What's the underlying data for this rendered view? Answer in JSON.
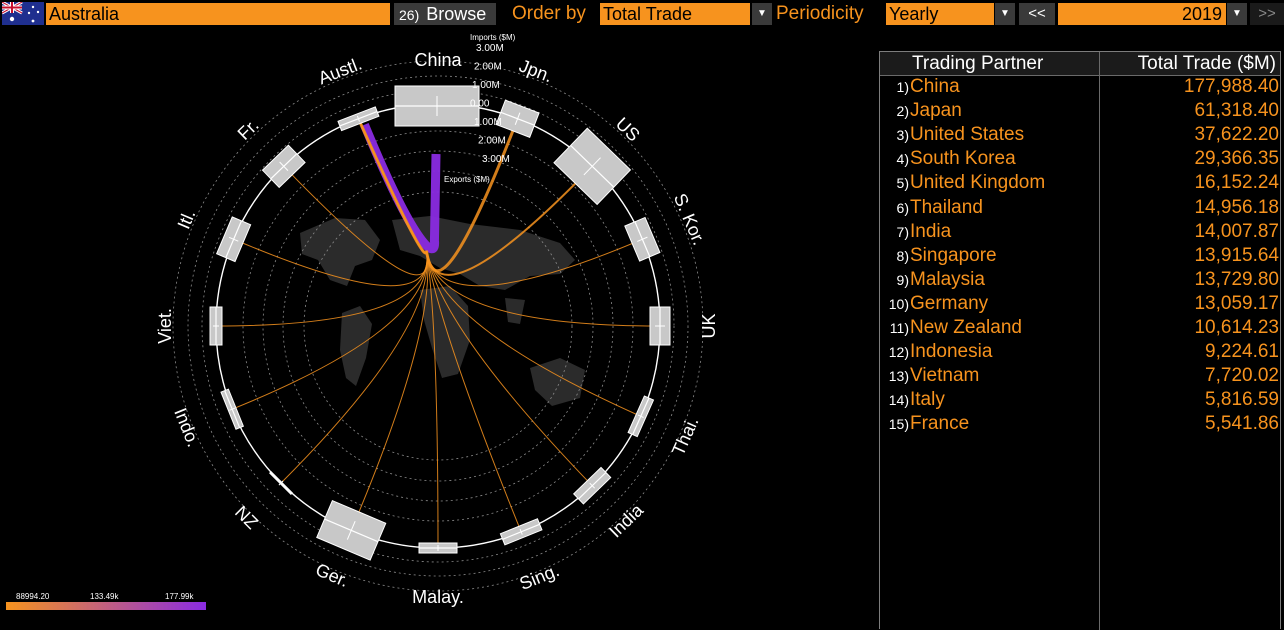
{
  "toolbar": {
    "country": "Australia",
    "browse_num": "26)",
    "browse_label": "Browse",
    "order_by_label": "Order by",
    "order_by_value": "Total Trade",
    "periodicity_label": "Periodicity",
    "periodicity_value": "Yearly",
    "prev_label": "<<",
    "year": "2019",
    "next_label": ">>"
  },
  "chord": {
    "center": "Austl.",
    "scale_imports_label": "Imports ($M)",
    "scale_exports_label": "Exports ($M)",
    "scale_ticks": [
      "3.00M",
      "2.00M",
      "1.00M",
      "0.00",
      "1.00M",
      "2.00M",
      "3.00M"
    ],
    "partners": [
      {
        "label": "China",
        "angle": 0
      },
      {
        "label": "Jpn.",
        "angle": 21
      },
      {
        "label": "US",
        "angle": 44
      },
      {
        "label": "S. Kor.",
        "angle": 67
      },
      {
        "label": "UK",
        "angle": 90
      },
      {
        "label": "Thai.",
        "angle": 114
      },
      {
        "label": "India",
        "angle": 136
      },
      {
        "label": "Sing.",
        "angle": 158
      },
      {
        "label": "Malay.",
        "angle": 180
      },
      {
        "label": "Ger.",
        "angle": 203
      },
      {
        "label": "NZ",
        "angle": 225
      },
      {
        "label": "Indo.",
        "angle": 248
      },
      {
        "label": "Viet.",
        "angle": 270
      },
      {
        "label": "Itl.",
        "angle": 293
      },
      {
        "label": "Fr.",
        "angle": 316
      },
      {
        "label": "Austl.",
        "angle": 339
      }
    ],
    "legend_ticks": [
      "88994.20",
      "133.49k",
      "177.99k"
    ],
    "colors": {
      "orange": "#f7931e",
      "purple": "#8a2be2",
      "box": "#c8c8c8"
    }
  },
  "table": {
    "col_partner": "Trading Partner",
    "col_total": "Total Trade ($M)",
    "rows": [
      {
        "rank": "1)",
        "name": "China",
        "value": "177,988.40"
      },
      {
        "rank": "2)",
        "name": "Japan",
        "value": "61,318.40"
      },
      {
        "rank": "3)",
        "name": "United States",
        "value": "37,622.20"
      },
      {
        "rank": "4)",
        "name": "South Korea",
        "value": "29,366.35"
      },
      {
        "rank": "5)",
        "name": "United Kingdom",
        "value": "16,152.24"
      },
      {
        "rank": "6)",
        "name": "Thailand",
        "value": "14,956.18"
      },
      {
        "rank": "7)",
        "name": "India",
        "value": "14,007.87"
      },
      {
        "rank": "8)",
        "name": "Singapore",
        "value": "13,915.64"
      },
      {
        "rank": "9)",
        "name": "Malaysia",
        "value": "13,729.80"
      },
      {
        "rank": "10)",
        "name": "Germany",
        "value": "13,059.17"
      },
      {
        "rank": "11)",
        "name": "New Zealand",
        "value": "10,614.23"
      },
      {
        "rank": "12)",
        "name": "Indonesia",
        "value": "9,224.61"
      },
      {
        "rank": "13)",
        "name": "Vietnam",
        "value": "7,720.02"
      },
      {
        "rank": "14)",
        "name": "Italy",
        "value": "5,816.59"
      },
      {
        "rank": "15)",
        "name": "France",
        "value": "5,541.86"
      }
    ]
  }
}
